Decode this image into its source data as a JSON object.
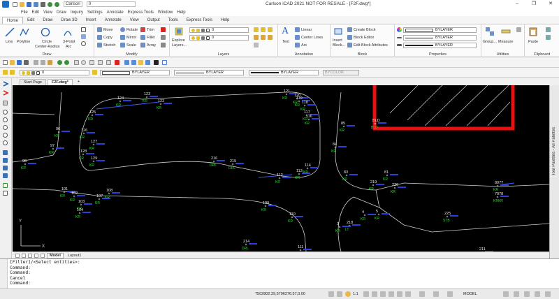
{
  "window": {
    "title": "Carlson iCAD 2021 NOT FOR RESALE - [F2F.dwg*]",
    "workspace": "Carlson",
    "undo_count": "0"
  },
  "menu": [
    "File",
    "Edit",
    "View",
    "Draw",
    "Inquiry",
    "Settings",
    "Annotate",
    "Express Tools",
    "Window",
    "Help"
  ],
  "ribbon_tabs": {
    "items": [
      "Home",
      "Edit",
      "Draw",
      "Draw 3D",
      "Insert",
      "Annotate",
      "View",
      "Output",
      "Tools",
      "Express Tools",
      "Help"
    ],
    "active": "Home"
  },
  "ribbon": {
    "draw": {
      "title": "Draw",
      "line": "Line",
      "polyline": "Polyline",
      "circle": "Circle",
      "circle_sub": "Center-Radius",
      "arc": "3-Point",
      "arc_sub": "Arc"
    },
    "modify": {
      "title": "Modify",
      "move": "Move",
      "rotate": "Rotate",
      "trim": "Trim",
      "copy": "Copy",
      "mirror": "Mirror",
      "fillet": "Fillet",
      "stretch": "Stretch",
      "scale": "Scale",
      "array": "Array"
    },
    "layers": {
      "title": "Layers",
      "explore": "Explore",
      "explore2": "Layers...",
      "layer_value": "0",
      "layer_value2": "0"
    },
    "annotation": {
      "title": "Annotation",
      "text": "Text",
      "linear": "Linear",
      "center_lines": "Center Lines",
      "arc": "Arc"
    },
    "block": {
      "title": "Block",
      "insert": "Insert",
      "insert2": "Block...",
      "create": "Create Block",
      "editor": "Block Editor",
      "attributes": "Edit Block Attributes"
    },
    "properties": {
      "title": "Properties",
      "color": "BYLAYER",
      "linetype": "BYLAYER",
      "lineweight": "BYLAYER"
    },
    "utilities": {
      "title": "Utilities",
      "group": "Group...",
      "measure": "Measure"
    },
    "clipboard": {
      "title": "Clipboard",
      "paste": "Paste"
    }
  },
  "propbar": {
    "layer": "0",
    "color": "BYLAYER",
    "linetype": "BYLAYER",
    "lineweight": "BYLAYER",
    "plotstyle": "BYCOLOR"
  },
  "doc_tabs": {
    "start": "Start Page",
    "active": "F2F.dwg*",
    "add": "+"
  },
  "layout_tabs": {
    "model": "Model",
    "layout1": "Layout1"
  },
  "palette_label": "Tool Palettes - All Palettes",
  "command_lines": [
    "[Filter]/<Select entities>:",
    "Command:",
    "Command:",
    "Cancel",
    "Command:"
  ],
  "status": {
    "coords": "7502802.29,5796276.57,0.00",
    "scale": "1:1",
    "model": "MODEL"
  },
  "points": [
    {
      "num": "124",
      "code": "KR"
    },
    {
      "num": "123",
      "code": "KR"
    },
    {
      "num": "122",
      "code": "KR"
    },
    {
      "num": "121",
      "code": "KR"
    },
    {
      "num": "120",
      "code": "KR"
    },
    {
      "num": "119",
      "code": "KR"
    },
    {
      "num": "118",
      "code": "KR"
    },
    {
      "num": "117",
      "code": "KR"
    },
    {
      "num": "116",
      "code": "KR"
    },
    {
      "num": "125",
      "code": "KR"
    },
    {
      "num": "126",
      "code": "KR"
    },
    {
      "num": "127",
      "code": "KR"
    },
    {
      "num": "128",
      "code": "KR"
    },
    {
      "num": "129",
      "code": "KR"
    },
    {
      "num": "96",
      "code": "KR"
    },
    {
      "num": "97",
      "code": "KR"
    },
    {
      "num": "98",
      "code": "KR"
    },
    {
      "num": "85",
      "code": "KR"
    },
    {
      "num": "84",
      "code": "KR"
    },
    {
      "num": "83",
      "code": "KR"
    },
    {
      "num": "219",
      "code": "KR"
    },
    {
      "num": "81",
      "code": "KR"
    },
    {
      "num": "220",
      "code": "KR"
    },
    {
      "num": "216",
      "code": "DRL"
    },
    {
      "num": "215",
      "code": "DRL"
    },
    {
      "num": "112",
      "code": "KR"
    },
    {
      "num": "113",
      "code": "KR"
    },
    {
      "num": "114",
      "code": "KR"
    },
    {
      "num": "101",
      "code": "KR"
    },
    {
      "num": "102",
      "code": "KR"
    },
    {
      "num": "103",
      "code": "KR"
    },
    {
      "num": "104",
      "code": "KR"
    },
    {
      "num": "107",
      "code": "KR"
    },
    {
      "num": "108",
      "code": "KR"
    },
    {
      "num": "109",
      "code": "KR"
    },
    {
      "num": "110",
      "code": "KR"
    },
    {
      "num": "214",
      "code": "DRL"
    },
    {
      "num": "111",
      "code": "KR"
    },
    {
      "num": "4",
      "code": "KR"
    },
    {
      "num": "5",
      "code": "KR"
    },
    {
      "num": "218",
      "code": "LT"
    },
    {
      "num": "3",
      "code": "KR"
    },
    {
      "num": "225",
      "code": "STB"
    },
    {
      "num": "8077",
      "code": "KR"
    },
    {
      "num": "7978",
      "code": "KRKR"
    },
    {
      "num": "211",
      "code": "KR"
    },
    {
      "num": "BLD",
      "code": "BLD"
    }
  ]
}
